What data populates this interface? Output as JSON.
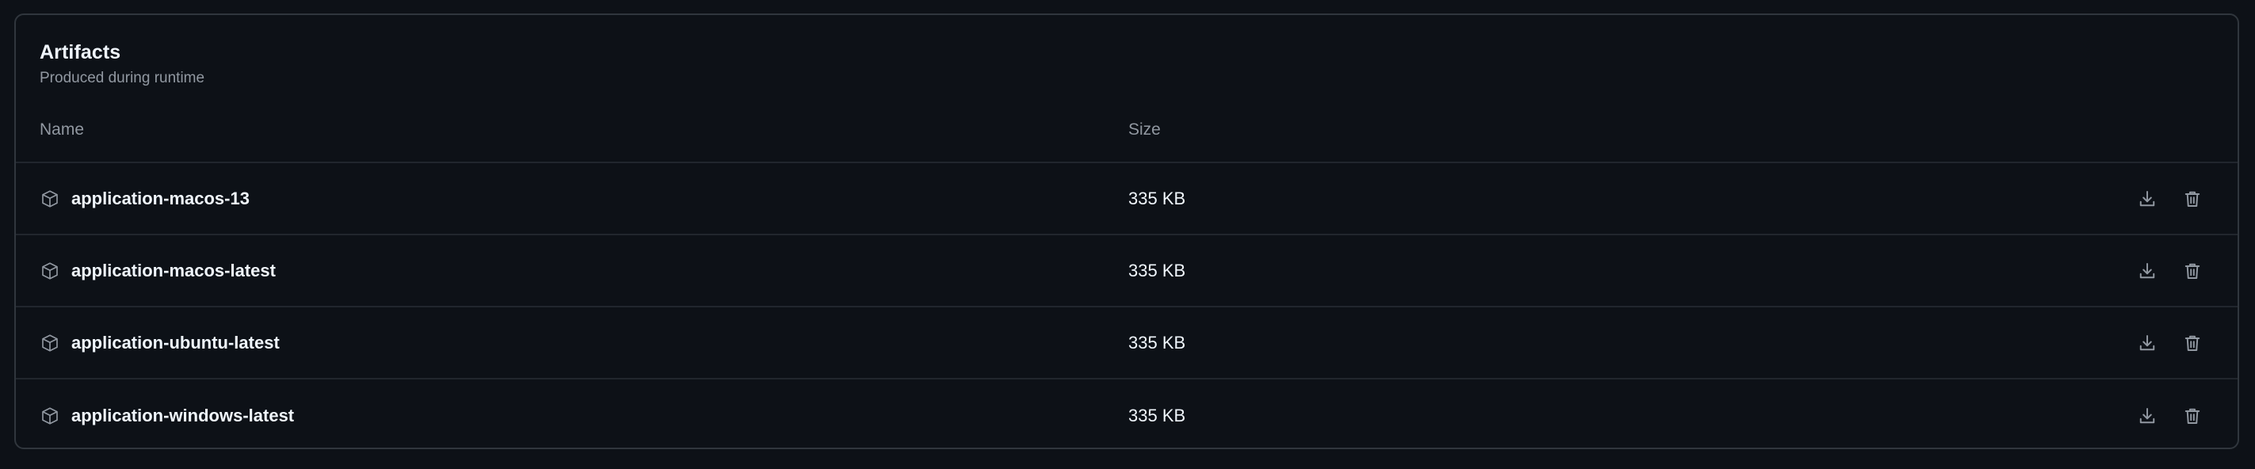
{
  "artifacts": {
    "title": "Artifacts",
    "subtitle": "Produced during runtime",
    "columns": {
      "name": "Name",
      "size": "Size"
    },
    "rows": [
      {
        "name": "application-macos-13",
        "size": "335 KB"
      },
      {
        "name": "application-macos-latest",
        "size": "335 KB"
      },
      {
        "name": "application-ubuntu-latest",
        "size": "335 KB"
      },
      {
        "name": "application-windows-latest",
        "size": "335 KB"
      }
    ],
    "icons": {
      "row": "package-icon",
      "download": "download-icon",
      "delete": "trash-icon"
    }
  },
  "colors": {
    "background": "#0d1117",
    "border": "#30363d",
    "row_divider": "#21262d",
    "text_primary": "#f0f6fc",
    "text_muted": "#9198a1"
  }
}
